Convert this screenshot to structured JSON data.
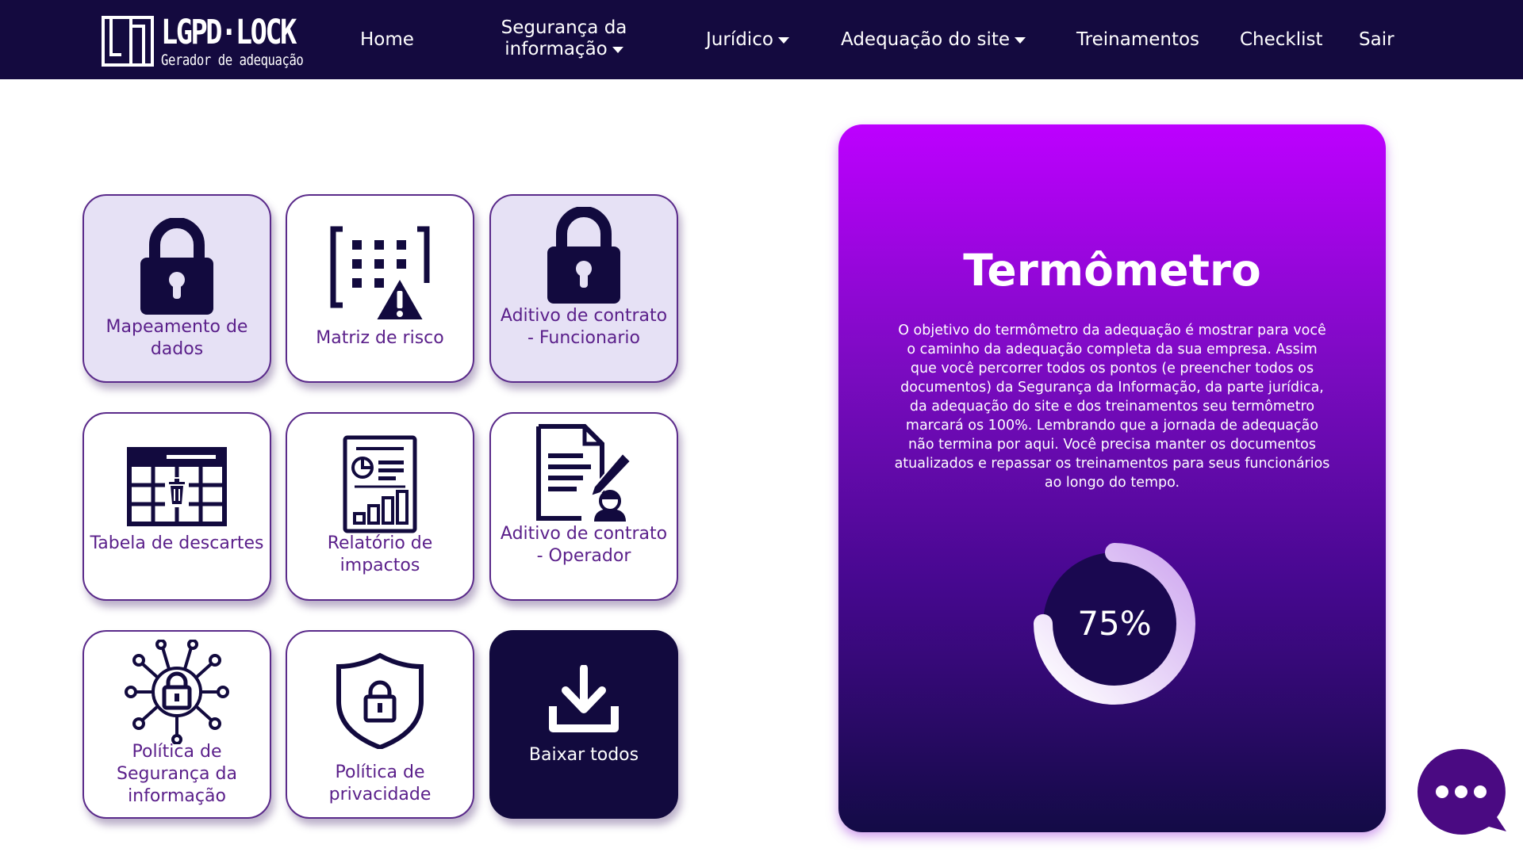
{
  "navbar": {
    "logo_title": "LGPD·LOCK",
    "logo_subtitle": "Gerador de adequação",
    "items": [
      {
        "label": "Home"
      },
      {
        "label_line1": "Segurança da",
        "label_line2": "informação"
      },
      {
        "label": "Jurídico"
      },
      {
        "label": "Adequação do site"
      },
      {
        "label": "Treinamentos"
      },
      {
        "label": "Checklist"
      },
      {
        "label": "Sair"
      }
    ]
  },
  "cards": [
    {
      "label": "Mapeamento de dados",
      "icon": "padlock-icon"
    },
    {
      "label": "Matriz de risco",
      "icon": "risk-matrix-icon"
    },
    {
      "label": "Aditivo de contrato - Funcionario",
      "icon": "padlock-icon"
    },
    {
      "label": "Tabela de descartes",
      "icon": "discard-table-icon"
    },
    {
      "label": "Relatório de impactos",
      "icon": "impact-report-icon"
    },
    {
      "label": "Aditivo de contrato - Operador",
      "icon": "contract-signing-icon"
    },
    {
      "label": "Política de Segurança da informação",
      "icon": "security-network-icon"
    },
    {
      "label": "Política de privacidade",
      "icon": "shield-lock-icon"
    },
    {
      "label": "Baixar todos",
      "icon": "download-icon"
    }
  ],
  "thermometer": {
    "title": "Termômetro",
    "description": "O objetivo do termômetro da adequação é mostrar para você o caminho da adequação completa da sua empresa. Assim que você percorrer todos os pontos (e preencher todos os documentos) da Segurança da Informação, da parte jurídica, da adequação do site e dos treinamentos seu termômetro marcará os 100%. Lembrando que a jornada de adequação não termina por aqui. Você precisa manter os documentos atualizados e repassar os treinamentos para seus funcionários ao longo do tempo.",
    "progress_label": "75%",
    "progress_fraction": 0.75
  },
  "colors": {
    "navbar_bg": "#140a3f",
    "accent_purple": "#5a1f8a",
    "card_lavender": "#e6e1f5",
    "dark_card": "#120a3e",
    "gradient_top": "#bd00ff",
    "gradient_bottom": "#130b46"
  },
  "chat": {
    "icon": "chat-bubble-icon"
  }
}
